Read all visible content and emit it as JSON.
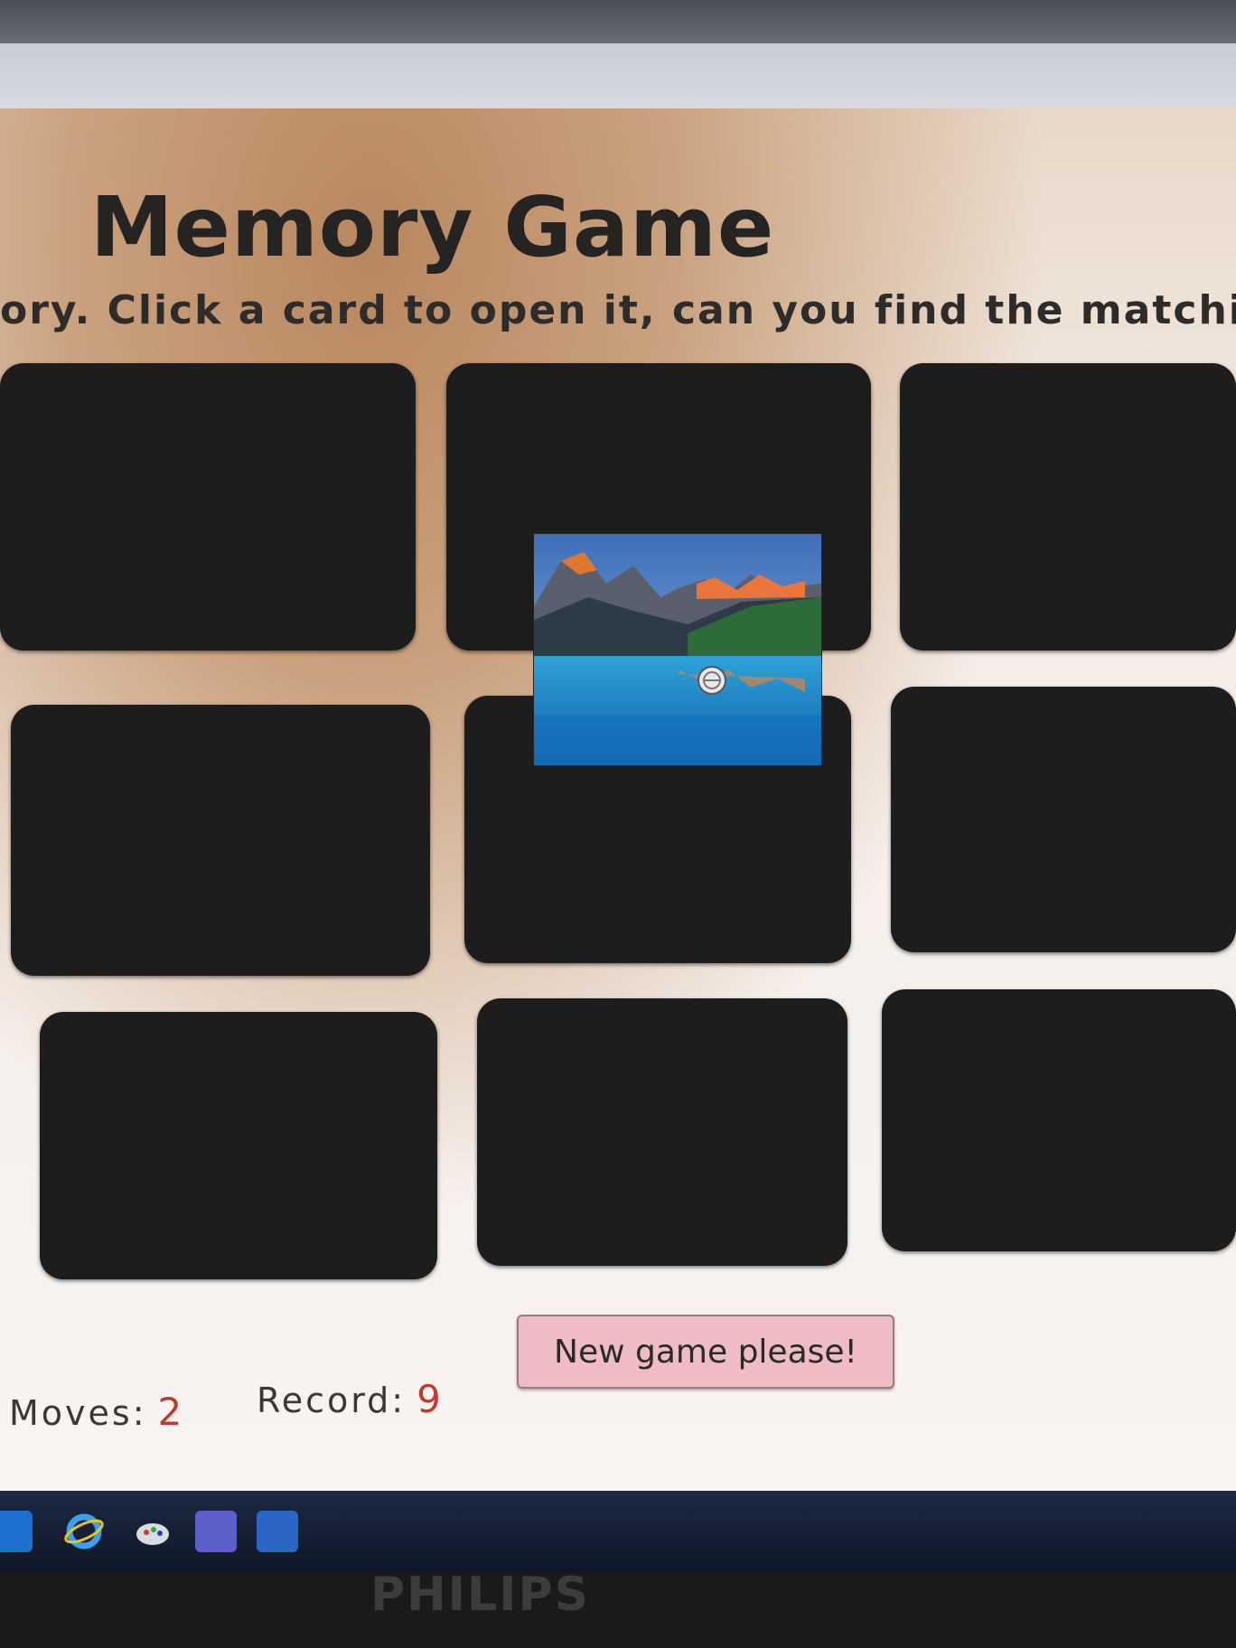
{
  "game": {
    "title": "Memory Game",
    "subtitle": "ory. Click a card to open it, can you find the matching",
    "cards": [
      {
        "state": "closed"
      },
      {
        "state": "open",
        "image": "mountain-lake-photo"
      },
      {
        "state": "closed"
      },
      {
        "state": "closed"
      },
      {
        "state": "closed"
      },
      {
        "state": "closed"
      },
      {
        "state": "closed"
      },
      {
        "state": "closed"
      },
      {
        "state": "closed"
      }
    ]
  },
  "stats": {
    "moves_label": "Moves:",
    "moves_value": "2",
    "record_label": "Record:",
    "record_value": "9"
  },
  "controls": {
    "new_game_label": "New game please!"
  },
  "taskbar": {
    "icons": [
      "outlook-icon",
      "internet-explorer-icon",
      "paint-icon",
      "teams-icon",
      "word-icon"
    ]
  },
  "monitor": {
    "brand": "PHILIPS"
  },
  "colors": {
    "card_back": "#1d1d1d",
    "stat_value": "#c0392b",
    "button_bg": "#eebcc2"
  }
}
